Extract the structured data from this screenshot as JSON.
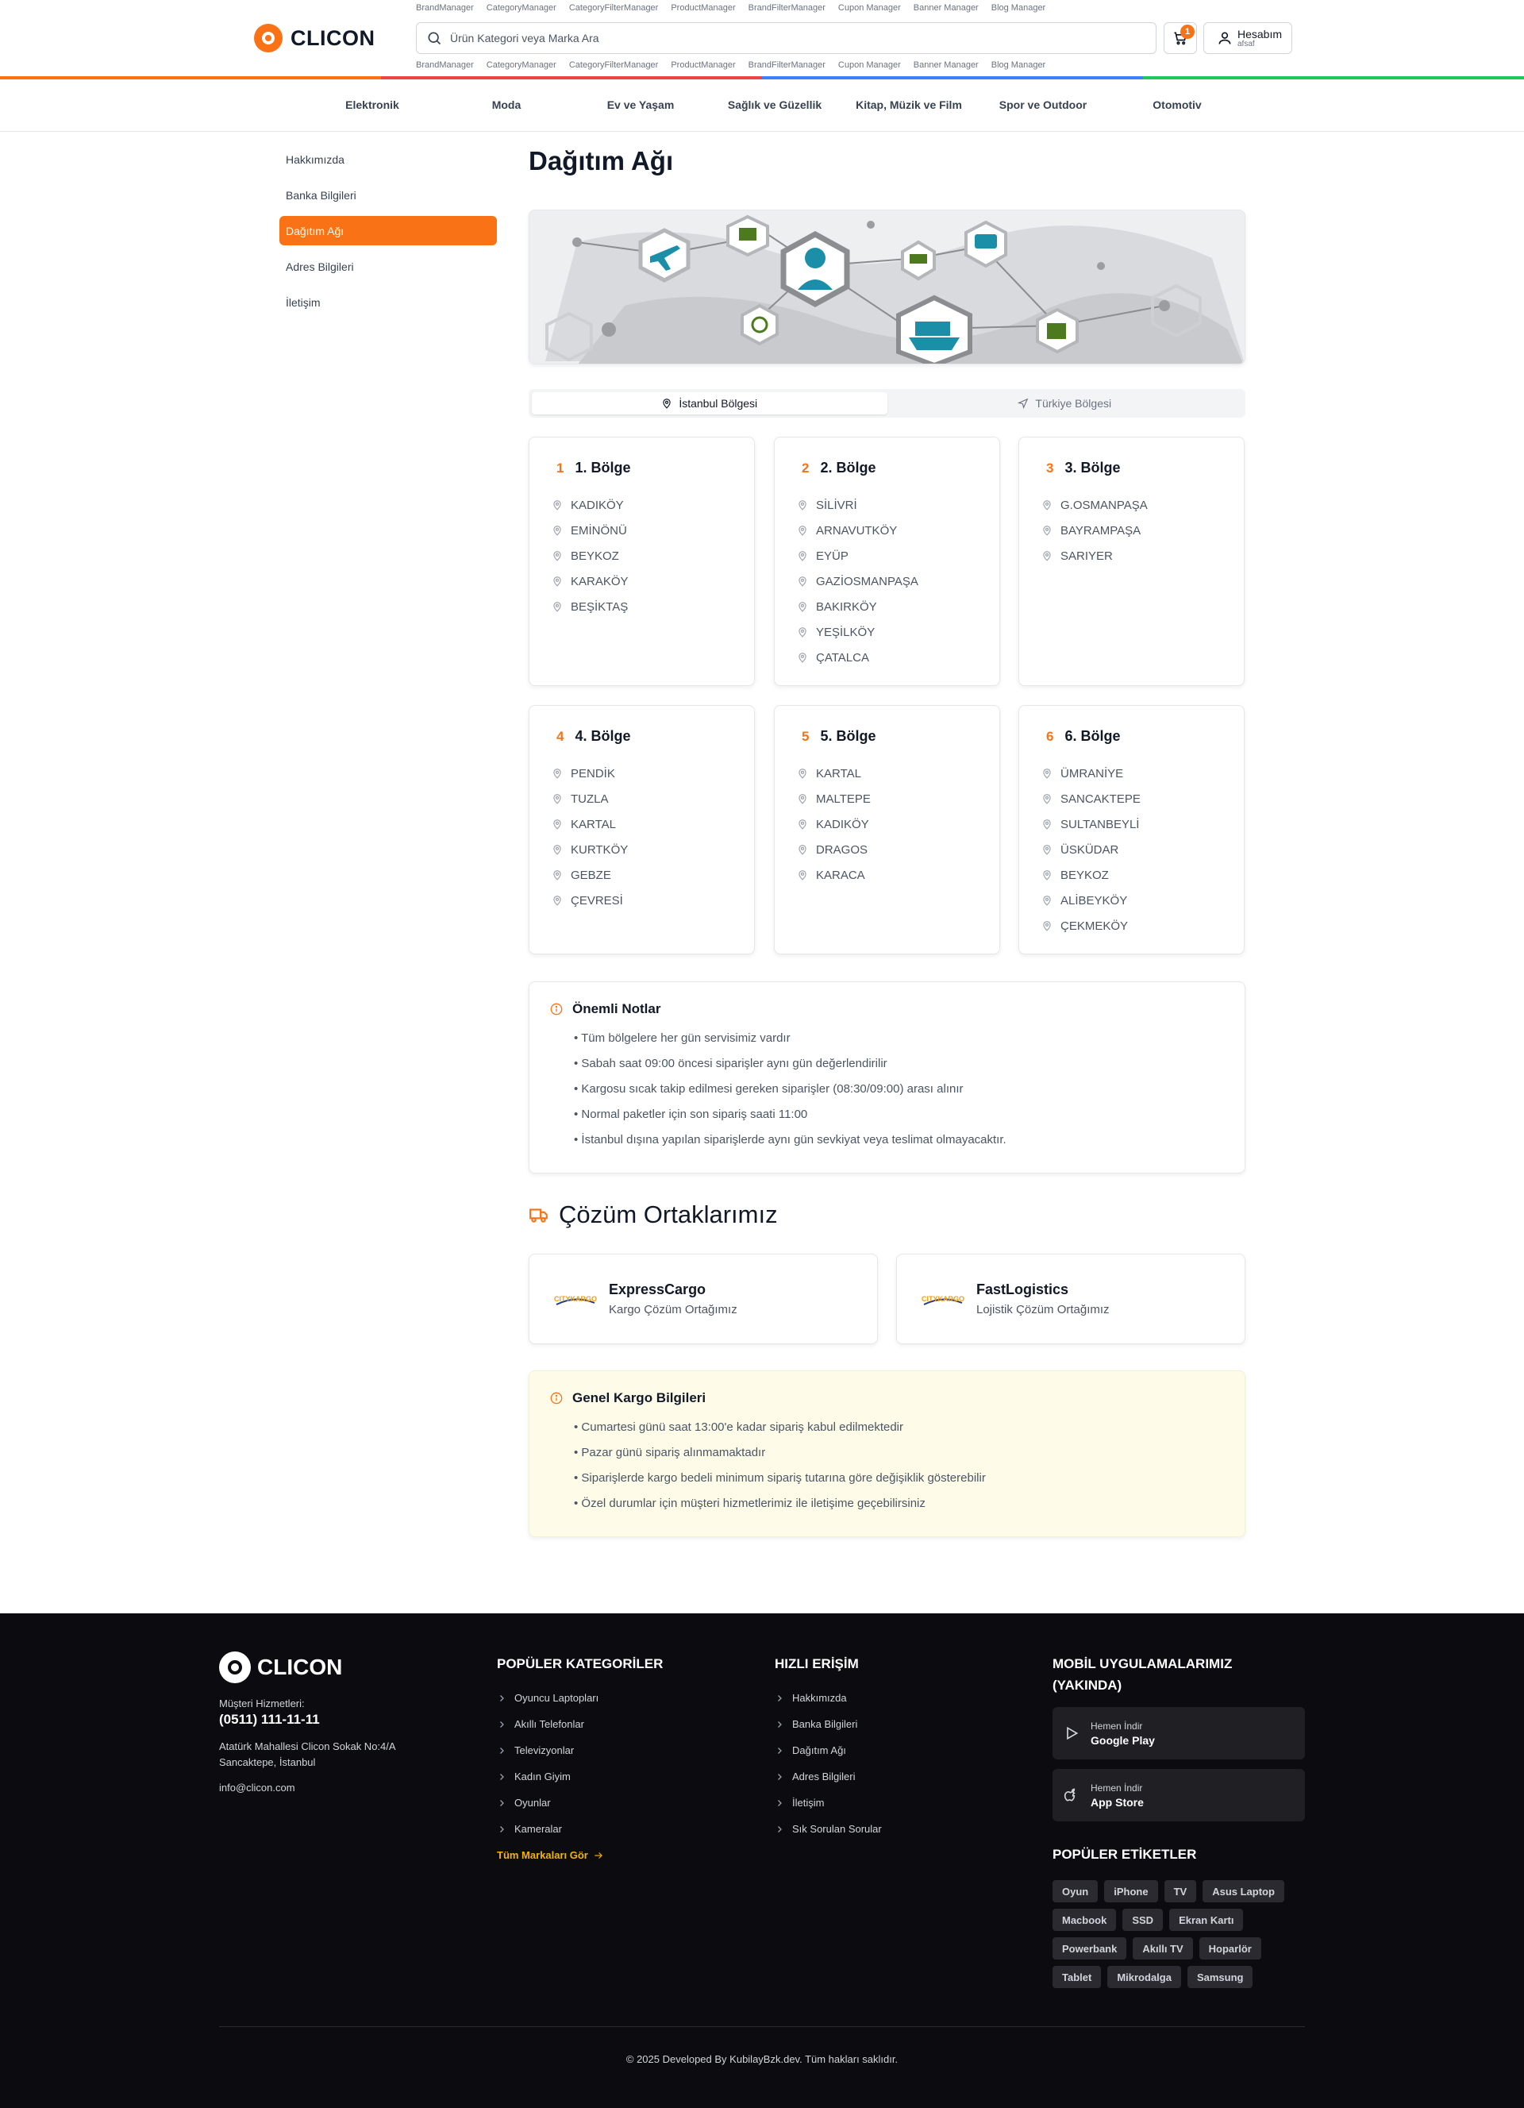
{
  "header": {
    "logo_text": "CLICON",
    "manager_links": [
      "BrandManager",
      "CategoryManager",
      "CategoryFilterManager",
      "ProductManager",
      "BrandFilterManager",
      "Cupon Manager",
      "Banner Manager",
      "Blog Manager"
    ],
    "search_placeholder": "Ürün Kategori veya Marka Ara",
    "cart_count": "1",
    "account_label": "Hesabım",
    "account_user": "afsaf",
    "stripe_colors": [
      "#f97316",
      "#ef4444",
      "#3b82f6",
      "#22c55e"
    ]
  },
  "categories": [
    "Elektronik",
    "Moda",
    "Ev ve Yaşam",
    "Sağlık ve Güzellik",
    "Kitap, Müzik ve Film",
    "Spor ve Outdoor",
    "Otomotiv"
  ],
  "sidebar": {
    "items": [
      "Hakkımızda",
      "Banka Bilgileri",
      "Dağıtım Ağı",
      "Adres Bilgileri",
      "İletişim"
    ],
    "active": "Dağıtım Ağı"
  },
  "main": {
    "title": "Dağıtım Ağı",
    "tabs": [
      {
        "label": "İstanbul Bölgesi",
        "icon": "map-pin-icon",
        "active": true
      },
      {
        "label": "Türkiye Bölgesi",
        "icon": "navigation-icon",
        "active": false
      }
    ],
    "regions": [
      {
        "num": "1",
        "name": "1. Bölge",
        "districts": [
          "KADIKÖY",
          "EMİNÖNÜ",
          "BEYKOZ",
          "KARAKÖY",
          "BEŞİKTAŞ"
        ]
      },
      {
        "num": "2",
        "name": "2. Bölge",
        "districts": [
          "SİLİVRİ",
          "ARNAVUTKÖY",
          "EYÜP",
          "GAZİOSMANPAŞA",
          "BAKIRKÖY",
          "YEŞİLKÖY",
          "ÇATALCA"
        ]
      },
      {
        "num": "3",
        "name": "3. Bölge",
        "districts": [
          "G.OSMANPAŞA",
          "BAYRAMPAŞA",
          "SARIYER"
        ]
      },
      {
        "num": "4",
        "name": "4. Bölge",
        "districts": [
          "PENDİK",
          "TUZLA",
          "KARTAL",
          "KURTKÖY",
          "GEBZE",
          "ÇEVRESİ"
        ]
      },
      {
        "num": "5",
        "name": "5. Bölge",
        "districts": [
          "KARTAL",
          "MALTEPE",
          "KADIKÖY",
          "DRAGOS",
          "KARACA"
        ]
      },
      {
        "num": "6",
        "name": "6. Bölge",
        "districts": [
          "ÜMRANİYE",
          "SANCAKTEPE",
          "SULTANBEYLİ",
          "ÜSKÜDAR",
          "BEYKOZ",
          "ALİBEYKÖY",
          "ÇEKMEKÖY"
        ]
      }
    ],
    "notes": {
      "title": "Önemli Notlar",
      "items": [
        "• Tüm bölgelere her gün servisimiz vardır",
        "• Sabah saat 09:00 öncesi siparişler aynı gün değerlendirilir",
        "• Kargosu sıcak takip edilmesi gereken siparişler (08:30/09:00) arası alınır",
        "• Normal paketler için son sipariş saati 11:00",
        "• İstanbul dışına yapılan siparişlerde aynı gün sevkiyat veya teslimat olmayacaktır."
      ]
    },
    "partners_title": "Çözüm Ortaklarımız",
    "partners": [
      {
        "name": "ExpressCargo",
        "desc": "Kargo Çözüm Ortağımız",
        "logo_text": "CITYKARGO"
      },
      {
        "name": "FastLogistics",
        "desc": "Lojistik Çözüm Ortağımız",
        "logo_text": "CITYKARGO"
      }
    ],
    "cargo_info": {
      "title": "Genel Kargo Bilgileri",
      "items": [
        "• Cumartesi günü saat 13:00'e kadar sipariş kabul edilmektedir",
        "• Pazar günü sipariş alınmamaktadır",
        "• Siparişlerde kargo bedeli minimum sipariş tutarına göre değişiklik gösterebilir",
        "• Özel durumlar için müşteri hizmetlerimiz ile iletişime geçebilirsiniz"
      ]
    },
    "accent_color": "#f97316"
  },
  "footer": {
    "logo_text": "CLICON",
    "support_label": "Müşteri Hizmetleri:",
    "phone": "(0511) 111-11-11",
    "address": "Atatürk Mahallesi Clicon Sokak No:4/A Sancaktepe, İstanbul",
    "email": "info@clicon.com",
    "popular_title": "POPÜLER KATEGORİLER",
    "popular": [
      "Oyuncu Laptopları",
      "Akıllı Telefonlar",
      "Televizyonlar",
      "Kadın Giyim",
      "Oyunlar",
      "Kameralar"
    ],
    "all_brands": "Tüm Markaları Gör",
    "quick_title": "HIZLI ERİŞİM",
    "quick": [
      "Hakkımızda",
      "Banka Bilgileri",
      "Dağıtım Ağı",
      "Adres Bilgileri",
      "İletişim",
      "Sık Sorulan Sorular"
    ],
    "mobile_title": "MOBİL UYGULAMALARIMIZ (YAKINDA)",
    "stores": [
      {
        "sub": "Hemen İndir",
        "name": "Google Play",
        "icon": "play-icon"
      },
      {
        "sub": "Hemen İndir",
        "name": "App Store",
        "icon": "apple-icon"
      }
    ],
    "tags_title": "POPÜLER ETİKETLER",
    "tags": [
      "Oyun",
      "iPhone",
      "TV",
      "Asus Laptop",
      "Macbook",
      "SSD",
      "Ekran Kartı",
      "Powerbank",
      "Akıllı TV",
      "Hoparlör",
      "Tablet",
      "Mikrodalga",
      "Samsung"
    ],
    "copyright": "© 2025 Developed By KubilayBzk.dev. Tüm hakları saklıdır."
  }
}
